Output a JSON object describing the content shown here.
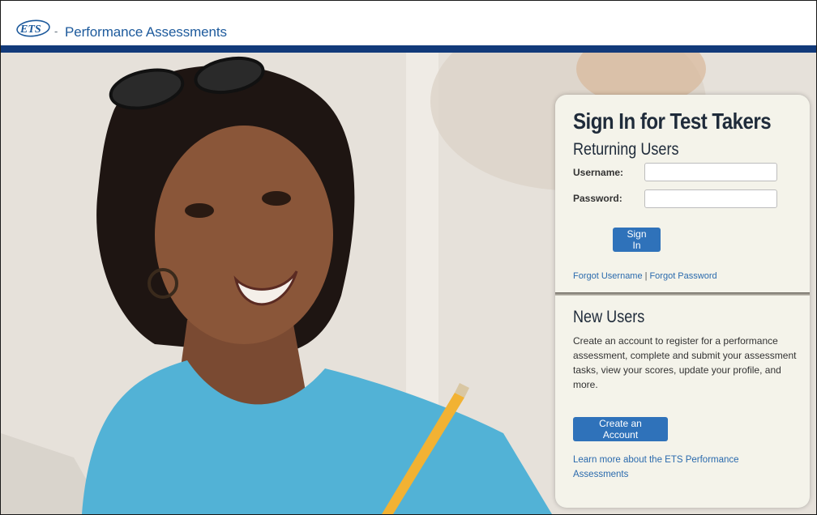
{
  "header": {
    "logo_text": "ETS",
    "separator": "-",
    "brand": "Performance Assessments"
  },
  "colors": {
    "header_rule": "#123a7a",
    "button": "#2f72ba",
    "link": "#2a6aad",
    "card_bg": "#f4f3ea"
  },
  "signin": {
    "title": "Sign In for Test Takers",
    "subtitle": "Returning Users",
    "username_label": "Username:",
    "username_value": "",
    "password_label": "Password:",
    "password_value": "",
    "signin_button": "Sign In",
    "forgot_username": "Forgot Username",
    "link_separator": "|",
    "forgot_password": "Forgot Password"
  },
  "new_users": {
    "title": "New Users",
    "description": "Create an account to register for a performance assessment, complete and submit your assessment tasks, view your scores, update your profile, and more.",
    "create_button": "Create an Account",
    "learn_more": "Learn more about the ETS Performance Assessments"
  }
}
